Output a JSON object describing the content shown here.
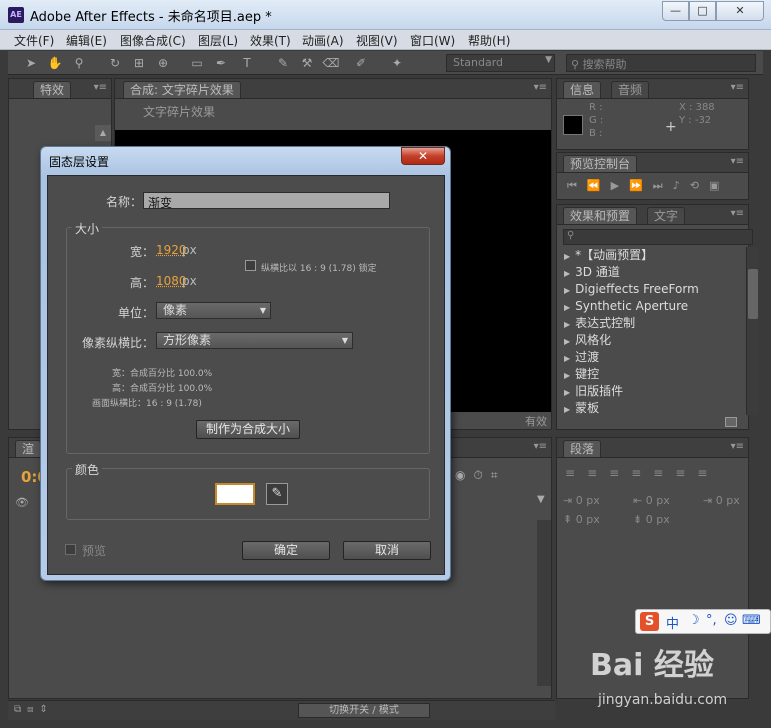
{
  "window": {
    "app_icon": "AE",
    "title": "Adobe After Effects - 未命名项目.aep *",
    "minimize": "—",
    "maximize": "□",
    "close": "✕"
  },
  "menu": [
    "文件(F)",
    "编辑(E)",
    "图像合成(C)",
    "图层(L)",
    "效果(T)",
    "动画(A)",
    "视图(V)",
    "窗口(W)",
    "帮助(H)"
  ],
  "toolbar": {
    "workspace": "Standard",
    "help_search_placeholder": "搜索帮助"
  },
  "panels": {
    "project_tab": "特效",
    "composition_tab": "合成: 文字碎片效果",
    "composition_name": "文字碎片效果",
    "info_tab": "信息",
    "audio_tab": "音频",
    "info": {
      "r": "R :",
      "g": "G :",
      "b": "B :",
      "x": "X : 388",
      "y": "Y : -32"
    },
    "preview_tab": "预览控制台",
    "effects_tab": "效果和预置",
    "text_tab": "文字",
    "effects_items": [
      "*【动画预置】",
      "3D 通道",
      "Digieffects FreeForm",
      "Synthetic Aperture",
      "表达式控制",
      "风格化",
      "过渡",
      "键控",
      "旧版插件",
      "蒙板"
    ],
    "paragraph_tab": "段落",
    "paragraph_values": [
      "0 px",
      "0 px",
      "0 px",
      "0 px",
      "0 px"
    ],
    "timeline_tab": "渲",
    "timecode": "0:0",
    "zoom": "有效",
    "switch_mode": "切换开关 / 模式"
  },
  "dialog": {
    "title": "固态层设置",
    "close": "✕",
    "name_label": "名称：",
    "name_value": "渐变",
    "size_group": "大小",
    "width_label": "宽：",
    "width_value": "1920",
    "width_unit": "px",
    "height_label": "高：",
    "height_value": "1080",
    "height_unit": "px",
    "lock_ratio_label": "纵横比以 16 : 9 (1.78) 锁定",
    "unit_label": "单位：",
    "unit_value": "像素",
    "pixel_aspect_label": "像素纵横比：",
    "pixel_aspect_value": "方形像素",
    "info_width": "宽：合成百分比 100.0%",
    "info_height": "高：合成百分比 100.0%",
    "info_frame_aspect": "画面纵横比：16 : 9 (1.78)",
    "make_comp_size_button": "制作为合成大小",
    "color_group": "颜色",
    "color_value": "#ffffff",
    "preview_label": "预览",
    "ok_button": "确定",
    "cancel_button": "取消"
  },
  "ime": {
    "logo": "S",
    "lang": "中",
    "moon": "☽",
    "punct": "°,",
    "face": "☺",
    "keyboard": "⌨"
  },
  "watermark": {
    "brand": "Bai 经验",
    "url": "jingyan.baidu.com"
  }
}
